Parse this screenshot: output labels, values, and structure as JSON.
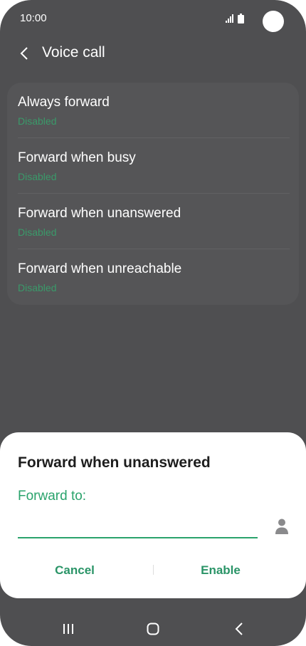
{
  "status_bar": {
    "time": "10:00",
    "icons": [
      "signal-icon",
      "battery-icon",
      "camera-icon"
    ]
  },
  "header": {
    "back_icon": "chevron-left-icon",
    "title": "Voice call"
  },
  "settings": {
    "items": [
      {
        "title": "Always forward",
        "status": "Disabled"
      },
      {
        "title": "Forward when busy",
        "status": "Disabled"
      },
      {
        "title": "Forward when unanswered",
        "status": "Disabled"
      },
      {
        "title": "Forward when unreachable",
        "status": "Disabled"
      }
    ]
  },
  "dialog": {
    "title": "Forward when unanswered",
    "field_label": "Forward to:",
    "field_value": "",
    "contact_icon": "person-icon",
    "cancel_label": "Cancel",
    "enable_label": "Enable"
  },
  "nav_bar": {
    "icons": [
      "recents-icon",
      "home-icon",
      "back-icon"
    ]
  },
  "colors": {
    "overlay_background": "#4f4f51",
    "card_background": "#555557",
    "accent_green": "#2aa36c",
    "status_green": "#3a9a6a",
    "dialog_background": "#ffffff"
  }
}
